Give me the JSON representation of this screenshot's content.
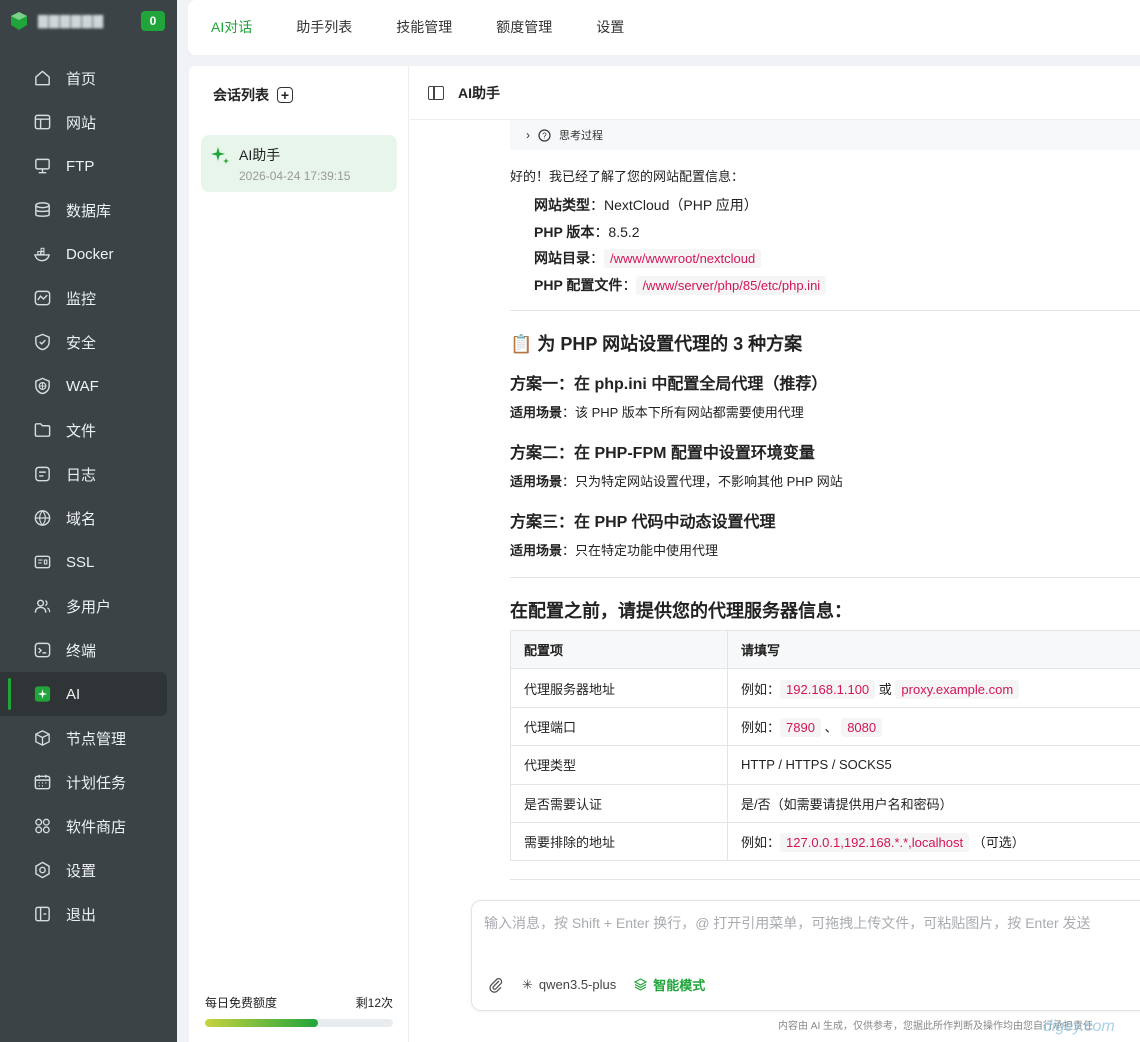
{
  "brand": {
    "name": "▇▇▇▇▇▇",
    "badge": "0"
  },
  "nav": [
    {
      "label": "首页",
      "icon": "home-icon"
    },
    {
      "label": "网站",
      "icon": "website-icon"
    },
    {
      "label": "FTP",
      "icon": "ftp-icon"
    },
    {
      "label": "数据库",
      "icon": "database-icon"
    },
    {
      "label": "Docker",
      "icon": "docker-icon"
    },
    {
      "label": "监控",
      "icon": "monitor-icon"
    },
    {
      "label": "安全",
      "icon": "shield-icon"
    },
    {
      "label": "WAF",
      "icon": "waf-icon"
    },
    {
      "label": "文件",
      "icon": "folder-icon"
    },
    {
      "label": "日志",
      "icon": "log-icon"
    },
    {
      "label": "域名",
      "icon": "globe-icon"
    },
    {
      "label": "SSL",
      "icon": "ssl-icon"
    },
    {
      "label": "多用户",
      "icon": "users-icon"
    },
    {
      "label": "终端",
      "icon": "terminal-icon"
    },
    {
      "label": "AI",
      "icon": "ai-icon",
      "active": true
    },
    {
      "label": "节点管理",
      "icon": "node-icon"
    },
    {
      "label": "计划任务",
      "icon": "calendar-icon"
    },
    {
      "label": "软件商店",
      "icon": "store-icon"
    },
    {
      "label": "设置",
      "icon": "settings-icon"
    },
    {
      "label": "退出",
      "icon": "logout-icon"
    }
  ],
  "tabs": [
    {
      "label": "AI对话",
      "active": true
    },
    {
      "label": "助手列表"
    },
    {
      "label": "技能管理"
    },
    {
      "label": "额度管理"
    },
    {
      "label": "设置"
    }
  ],
  "sessions": {
    "header": "会话列表",
    "items": [
      {
        "title": "AI助手",
        "time": "2026-04-24 17:39:15"
      }
    ]
  },
  "quota": {
    "label": "每日免费额度",
    "remaining": "剩12次",
    "fraction": 0.6
  },
  "chat": {
    "title": "AI助手",
    "thinking_label": "思考过程",
    "intro": "好的！我已经了解了您的网站配置信息：",
    "info": [
      {
        "key": "网站类型",
        "value": "：NextCloud（PHP 应用）"
      },
      {
        "key": "PHP 版本",
        "value": "：8.5.2"
      },
      {
        "key": "网站目录",
        "value": "：",
        "code": "/www/wwwroot/nextcloud"
      },
      {
        "key": "PHP 配置文件",
        "value": "：",
        "code": "/www/server/php/85/etc/php.ini"
      }
    ],
    "section_title": "📋 为 PHP 网站设置代理的 3 种方案",
    "plans": [
      {
        "title": "方案一：在 php.ini 中配置全局代理（推荐）",
        "scene_key": "适用场景",
        "scene": "：该 PHP 版本下所有网站都需要使用代理"
      },
      {
        "title": "方案二：在 PHP-FPM 配置中设置环境变量",
        "scene_key": "适用场景",
        "scene": "：只为特定网站设置代理，不影响其他 PHP 网站"
      },
      {
        "title": "方案三：在 PHP 代码中动态设置代理",
        "scene_key": "适用场景",
        "scene": "：只在特定功能中使用代理"
      }
    ],
    "request_title": "在配置之前，请提供您的代理服务器信息：",
    "table": {
      "headers": [
        "配置项",
        "请填写"
      ],
      "rows": [
        {
          "item": "代理服务器地址",
          "pre": "例如：",
          "code1": "192.168.1.100",
          "mid": "或",
          "code2": "proxy.example.com",
          "post": ""
        },
        {
          "item": "代理端口",
          "pre": "例如：",
          "code1": "7890",
          "mid": "、",
          "code2": "8080",
          "post": ""
        },
        {
          "item": "代理类型",
          "pre": "HTTP / HTTPS / SOCKS5",
          "code1": "",
          "mid": "",
          "code2": "",
          "post": ""
        },
        {
          "item": "是否需要认证",
          "pre": "是/否（如需要请提供用户名和密码）",
          "code1": "",
          "mid": "",
          "code2": "",
          "post": ""
        },
        {
          "item": "需要排除的地址",
          "pre": "例如：",
          "code1": "127.0.0.1,192.168.*.*,localhost",
          "mid": "",
          "code2": "",
          "post": "（可选）"
        }
      ]
    }
  },
  "input": {
    "placeholder": "输入消息，按 Shift + Enter 换行，@ 打开引用菜单，可拖拽上传文件，可粘贴图片，按 Enter 发送",
    "model": "qwen3.5-plus",
    "mode": "智能模式"
  },
  "disclaimer": "内容由 AI 生成，仅供参考，您据此所作判断及操作均由您自行承担责任",
  "watermark": "digey.com",
  "colors": {
    "accent": "#20a53a",
    "sidebar": "#3b4346",
    "code": "#d4145a"
  }
}
